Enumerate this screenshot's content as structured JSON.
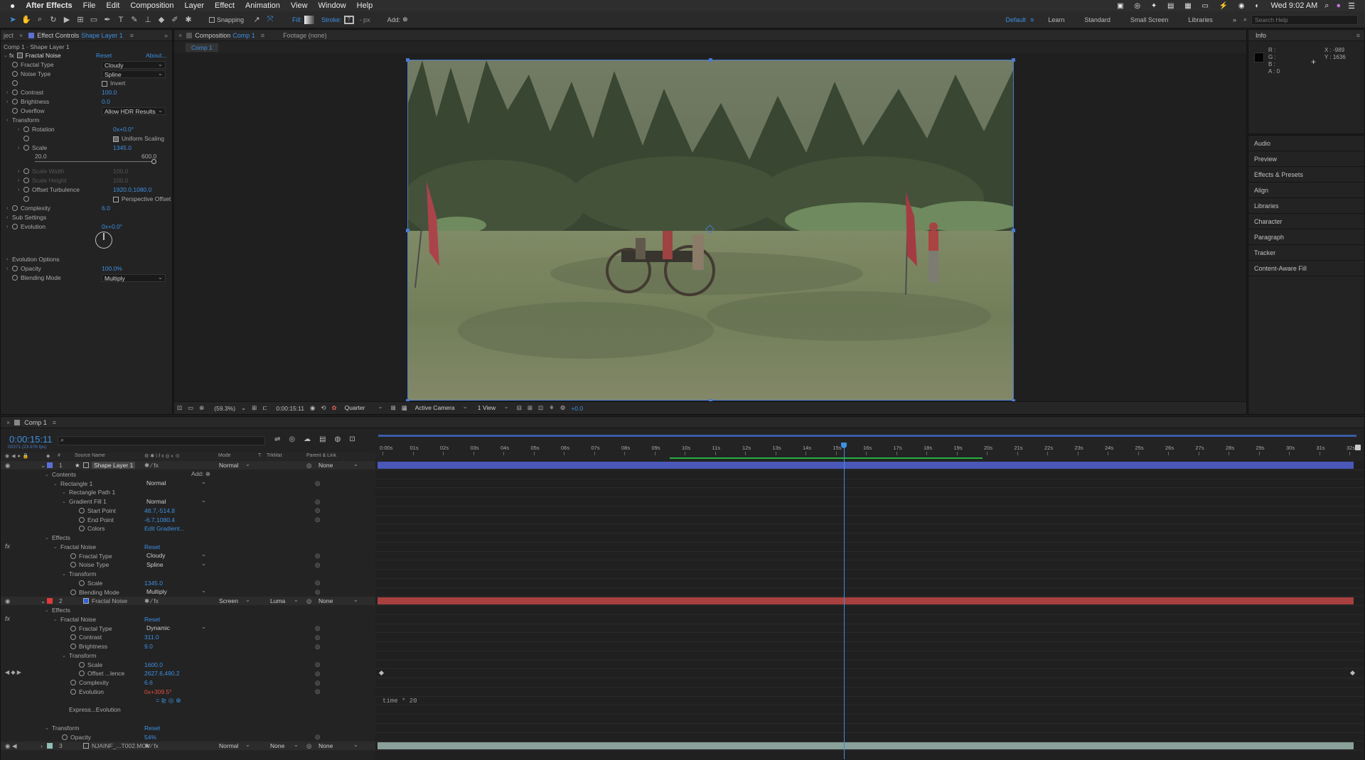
{
  "menubar": {
    "apple": "",
    "app": "After Effects",
    "items": [
      "File",
      "Edit",
      "Composition",
      "Layer",
      "Effect",
      "Animation",
      "View",
      "Window",
      "Help"
    ],
    "clock": "Wed 9:02 AM"
  },
  "toolbar": {
    "snapping": "Snapping",
    "fill": "Fill:",
    "stroke": "Stroke:",
    "stroke_px": "- px",
    "add": "Add:",
    "workspaces": [
      "Default",
      "Learn",
      "Standard",
      "Small Screen",
      "Libraries"
    ],
    "active_workspace": "Default",
    "search_placeholder": "Search Help"
  },
  "effect_controls": {
    "tab_left": "ject",
    "tab": "Effect Controls",
    "tab_layer": "Shape Layer 1",
    "breadcrumb": "Comp 1 · Shape Layer 1",
    "effect_name": "Fractal Noise",
    "reset": "Reset",
    "about": "About...",
    "rows": [
      {
        "label": "Fractal Type",
        "dropdown": "Cloudy"
      },
      {
        "label": "Noise Type",
        "dropdown": "Spline"
      },
      {
        "label": "",
        "checkbox": "Invert"
      },
      {
        "label": "Contrast",
        "value": "100.0"
      },
      {
        "label": "Brightness",
        "value": "0.0"
      },
      {
        "label": "Overflow",
        "dropdown": "Allow HDR Results"
      },
      {
        "label": "Transform"
      },
      {
        "label": "Rotation",
        "value": "0x+0.0°"
      },
      {
        "label": "",
        "checkbox": "Uniform Scaling",
        "checked": true
      },
      {
        "label": "Scale",
        "value": "1345.0"
      }
    ],
    "scale_min": "20.0",
    "scale_max": "600.0",
    "rows2": [
      {
        "label": "Scale Width",
        "value": "100.0",
        "dim": true
      },
      {
        "label": "Scale Height",
        "value": "100.0",
        "dim": true
      },
      {
        "label": "Offset Turbulence",
        "value": "1920.0,1080.0"
      },
      {
        "label": "",
        "checkbox": "Perspective Offset"
      },
      {
        "label": "Complexity",
        "value": "6.0"
      },
      {
        "label": "Sub Settings"
      },
      {
        "label": "Evolution",
        "value": "0x+0.0°"
      }
    ],
    "rows3": [
      {
        "label": "Evolution Options"
      },
      {
        "label": "Opacity",
        "value": "100.0%"
      },
      {
        "label": "Blending Mode",
        "dropdown": "Multiply"
      }
    ]
  },
  "composition": {
    "tab": "Composition",
    "tab_comp": "Comp 1",
    "footage_tab": "Footage (none)",
    "comp_chip": "Comp 1",
    "zoom": "(59.3%)",
    "timecode": "0:00:15:11",
    "resolution": "Quarter",
    "camera": "Active Camera",
    "views": "1 View",
    "exposure": "+0.0"
  },
  "info": {
    "title": "Info",
    "r": "R :",
    "g": "G :",
    "b": "B :",
    "a": "A : 0",
    "x": "X : -989",
    "y": "Y : 1636"
  },
  "right_panels": [
    "Audio",
    "Preview",
    "Effects & Presets",
    "Align",
    "Libraries",
    "Character",
    "Paragraph",
    "Tracker",
    "Content-Aware Fill"
  ],
  "timeline": {
    "tab": "Comp 1",
    "timecode": "0:00:15:11",
    "frames": "00371 (23.976 fps)",
    "headers": {
      "source": "Source Name",
      "mode": "Mode",
      "t": "T",
      "trkmat": "TrkMat",
      "parent": "Parent & Link"
    },
    "ruler": [
      "0:00s",
      "01s",
      "02s",
      "03s",
      "04s",
      "05s",
      "06s",
      "07s",
      "08s",
      "09s",
      "10s",
      "11s",
      "12s",
      "13s",
      "14s",
      "15s",
      "16s",
      "17s",
      "18s",
      "19s",
      "20s",
      "21s",
      "22s",
      "23s",
      "24s",
      "25s",
      "26s",
      "27s",
      "28s",
      "29s",
      "30s",
      "31s",
      "32s"
    ],
    "rows": [
      {
        "type": "layer",
        "num": "1",
        "name": "Shape Layer 1",
        "mode": "Normal",
        "parent": "None",
        "color": "#5b6fd6"
      },
      {
        "indent": 1,
        "label": "Contents",
        "add": "Add:"
      },
      {
        "indent": 2,
        "label": "Rectangle 1",
        "mode": "Normal"
      },
      {
        "indent": 3,
        "label": "Rectangle Path 1"
      },
      {
        "indent": 3,
        "label": "Gradient Fill 1",
        "mode": "Normal"
      },
      {
        "indent": 4,
        "label": "Start Point",
        "value": "48.7,-514.8"
      },
      {
        "indent": 4,
        "label": "End Point",
        "value": "-6.7,1080.4"
      },
      {
        "indent": 4,
        "label": "Colors",
        "value": "Edit Gradient..."
      },
      {
        "indent": 1,
        "label": "Effects"
      },
      {
        "indent": 2,
        "label": "Fractal Noise",
        "value": "Reset"
      },
      {
        "indent": 3,
        "label": "Fractal Type",
        "mode": "Cloudy"
      },
      {
        "indent": 3,
        "label": "Noise Type",
        "mode": "Spline"
      },
      {
        "indent": 3,
        "label": "Transform"
      },
      {
        "indent": 4,
        "label": "Scale",
        "value": "1345.0"
      },
      {
        "indent": 3,
        "label": "Blending Mode",
        "mode": "Multiply"
      },
      {
        "type": "layer",
        "num": "2",
        "name": "Fractal Noise",
        "mode": "Screen",
        "trkmat": "Luma",
        "parent": "None",
        "color": "#e23a3a"
      },
      {
        "indent": 1,
        "label": "Effects"
      },
      {
        "indent": 2,
        "label": "Fractal Noise",
        "value": "Reset"
      },
      {
        "indent": 3,
        "label": "Fractal Type",
        "mode": "Dynamic"
      },
      {
        "indent": 3,
        "label": "Contrast",
        "value": "311.0"
      },
      {
        "indent": 3,
        "label": "Brightness",
        "value": "9.0"
      },
      {
        "indent": 3,
        "label": "Transform"
      },
      {
        "indent": 4,
        "label": "Scale",
        "value": "1600.0"
      },
      {
        "indent": 4,
        "label": "Offset ...lence",
        "value": "2627.6,490.2"
      },
      {
        "indent": 3,
        "label": "Complexity",
        "value": "6.6"
      },
      {
        "indent": 3,
        "label": "Evolution",
        "value": "0x+309.5°",
        "red": true
      },
      {
        "indent": 4,
        "label": ""
      },
      {
        "indent": 3,
        "label": "Express...Evolution"
      },
      {
        "indent": 1,
        "label": ""
      },
      {
        "indent": 1,
        "label": "Transform",
        "value": "Reset"
      },
      {
        "indent": 2,
        "label": "Opacity",
        "value": "54%"
      },
      {
        "type": "layer",
        "num": "3",
        "name": "NJAINF_...T002.MOV",
        "mode": "Normal",
        "trkmat": "None",
        "parent": "None",
        "color": "#8fbfb7"
      }
    ],
    "expression": "time * 20"
  }
}
